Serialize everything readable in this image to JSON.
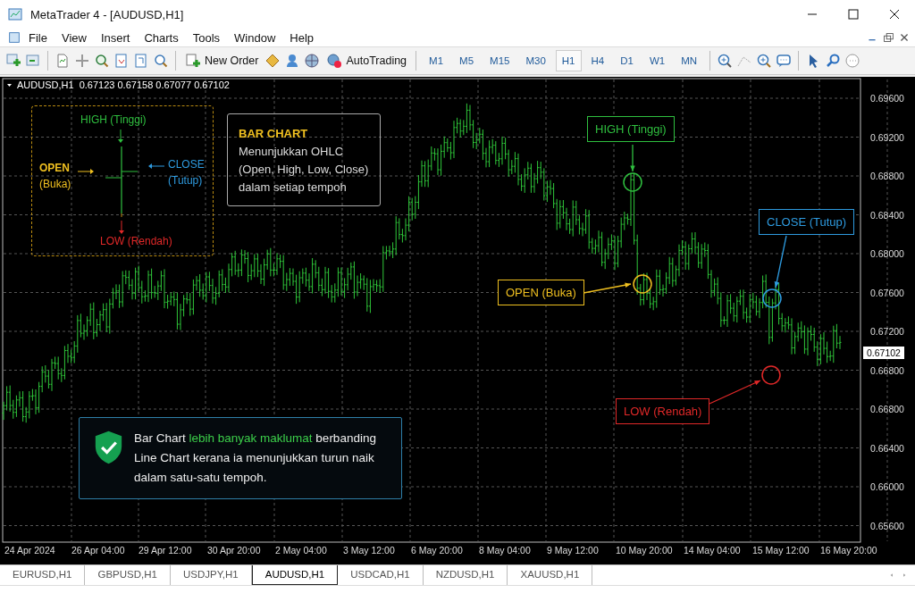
{
  "window": {
    "title": "MetaTrader 4 - [AUDUSD,H1]"
  },
  "menu": [
    "File",
    "View",
    "Insert",
    "Charts",
    "Tools",
    "Window",
    "Help"
  ],
  "toolbar": {
    "new_order": "New Order",
    "auto_trading": "AutoTrading"
  },
  "timeframes": [
    {
      "label": "M1",
      "selected": false
    },
    {
      "label": "M5",
      "selected": false
    },
    {
      "label": "M15",
      "selected": false
    },
    {
      "label": "M30",
      "selected": false
    },
    {
      "label": "H1",
      "selected": true
    },
    {
      "label": "H4",
      "selected": false
    },
    {
      "label": "D1",
      "selected": false
    },
    {
      "label": "W1",
      "selected": false
    },
    {
      "label": "MN",
      "selected": false
    }
  ],
  "chart": {
    "header": "AUDUSD,H1  0.67123 0.67158 0.67077 0.67102",
    "price_labels": [
      "0.69600",
      "0.69200",
      "0.68800",
      "0.68400",
      "0.68000",
      "0.67600",
      "0.67200",
      "0.66800",
      "0.66800",
      "0.66400",
      "0.66000",
      "0.65600"
    ],
    "current_price": "0.67102",
    "time_labels": [
      "24 Apr 2024",
      "26 Apr 04:00",
      "29 Apr 12:00",
      "30 Apr 20:00",
      "2 May 04:00",
      "3 May 12:00",
      "6 May 20:00",
      "8 May 04:00",
      "9 May 12:00",
      "10 May 20:00",
      "14 May 04:00",
      "15 May 12:00",
      "16 May 20:00"
    ]
  },
  "legend": {
    "high": "HIGH (Tinggi)",
    "open": "OPEN",
    "open_sub": "(Buka)",
    "close": "CLOSE",
    "close_sub": "(Tutup)",
    "low": "LOW (Rendah)"
  },
  "info": {
    "title": "BAR CHART",
    "lines": [
      "Menunjukkan OHLC",
      "(Open, High, Low, Close)",
      "dalam setiap tempoh"
    ]
  },
  "callouts": [
    {
      "kind": "high",
      "label": "HIGH (Tinggi)",
      "color": "#2fbf3f"
    },
    {
      "kind": "open",
      "label": "OPEN (Buka)",
      "color": "#f0c020"
    },
    {
      "kind": "close",
      "label": "CLOSE (Tutup)",
      "color": "#2e9be0"
    },
    {
      "kind": "low",
      "label": "LOW (Rendah)",
      "color": "#e02828"
    }
  ],
  "note": {
    "segments": [
      {
        "text": "Bar Chart ",
        "highlight": false
      },
      {
        "text": "lebih banyak maklumat",
        "highlight": true
      },
      {
        "text": " berbanding Line Chart kerana ia menunjukkan turun naik dalam satu-satu tempoh.",
        "highlight": false
      }
    ]
  },
  "tabs": [
    {
      "label": "EURUSD,H1",
      "selected": false
    },
    {
      "label": "GBPUSD,H1",
      "selected": false
    },
    {
      "label": "USDJPY,H1",
      "selected": false
    },
    {
      "label": "AUDUSD,H1",
      "selected": true
    },
    {
      "label": "USDCAD,H1",
      "selected": false
    },
    {
      "label": "NZDUSD,H1",
      "selected": false
    },
    {
      "label": "XAUUSD,H1",
      "selected": false
    }
  ]
}
